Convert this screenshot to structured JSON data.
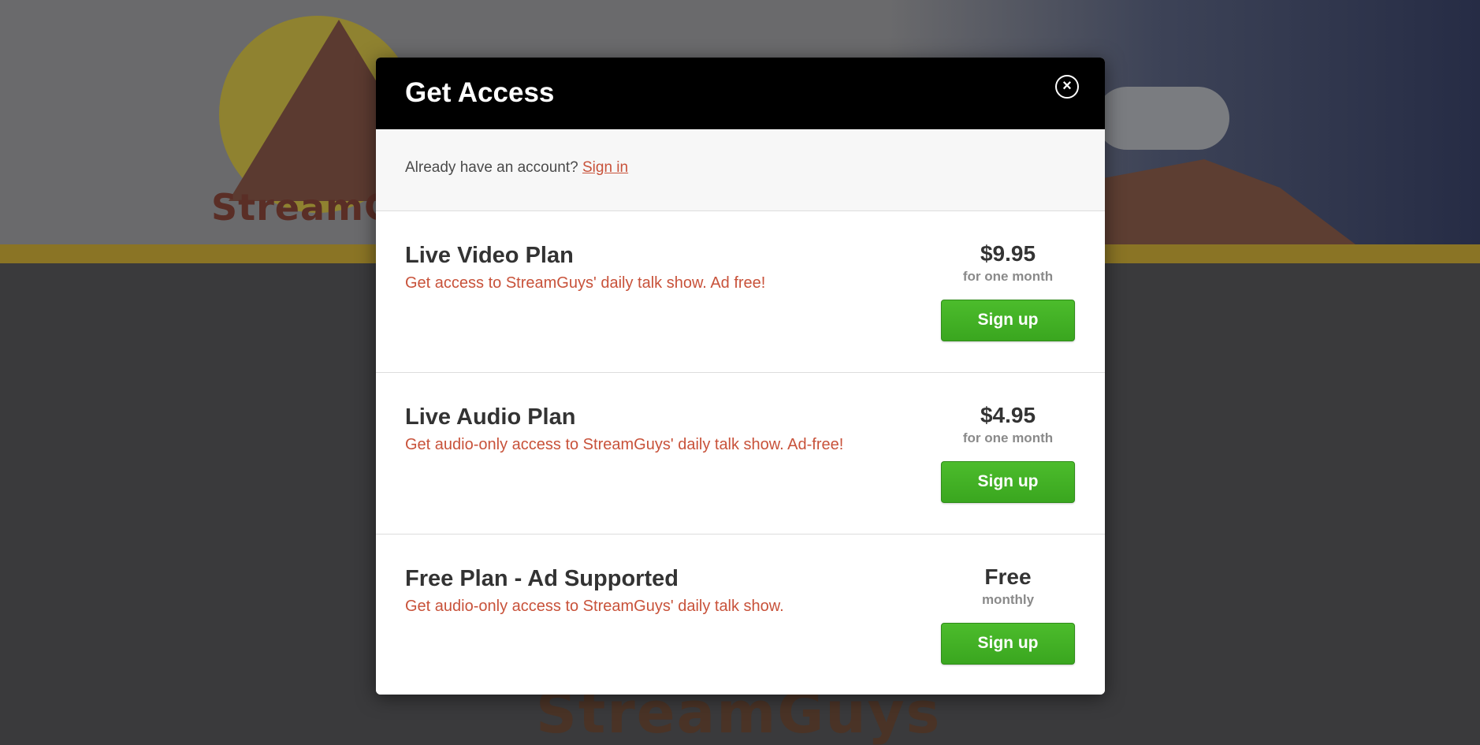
{
  "background": {
    "logo_text": "StreamGu",
    "bottom_text": "StreamGuys"
  },
  "modal": {
    "title": "Get Access",
    "close_icon": "close-circle-icon",
    "signin": {
      "prompt": "Already have an account?",
      "link_label": "Sign in"
    },
    "plans": [
      {
        "name": "Live Video Plan",
        "description": "Get access to StreamGuys' daily talk show. Ad free!",
        "price": "$9.95",
        "period": "for one month",
        "button_label": "Sign up"
      },
      {
        "name": "Live Audio Plan",
        "description": "Get audio-only access to StreamGuys' daily talk show. Ad-free!",
        "price": "$4.95",
        "period": "for one month",
        "button_label": "Sign up"
      },
      {
        "name": "Free Plan - Ad Supported",
        "description": "Get audio-only access to StreamGuys' daily talk show.",
        "price": "Free",
        "period": "monthly",
        "button_label": "Sign up"
      }
    ]
  },
  "colors": {
    "accent": "#c8523a",
    "button": "#3fae22",
    "header": "#000000"
  }
}
